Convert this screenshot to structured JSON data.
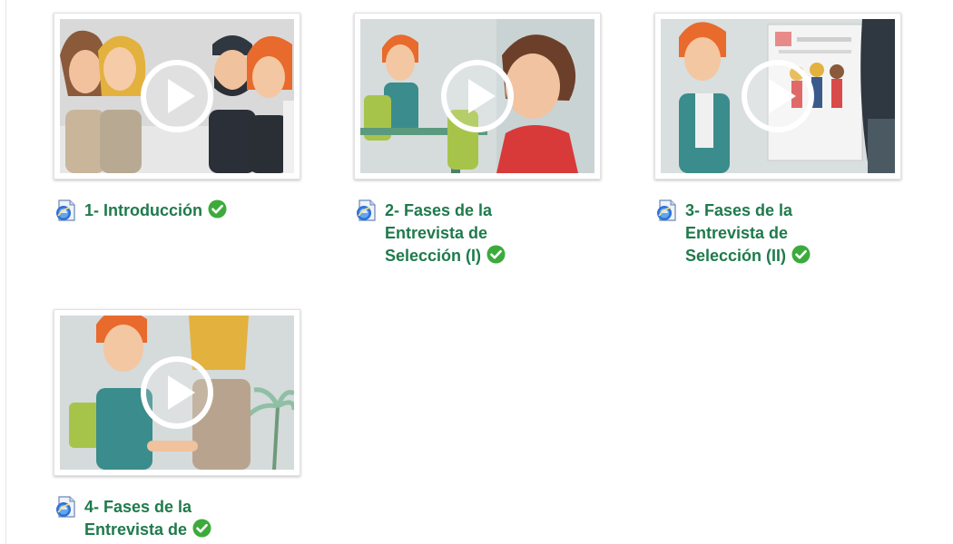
{
  "activities": [
    {
      "title": "1- Introducción",
      "completed": true,
      "icon": "video-resource-icon"
    },
    {
      "title": "2- Fases de la Entrevista de Selección (I)",
      "completed": true,
      "icon": "video-resource-icon"
    },
    {
      "title": "3- Fases de la Entrevista de Selección (II)",
      "completed": true,
      "icon": "video-resource-icon"
    },
    {
      "title": "4- Fases de la Entrevista de",
      "completed": true,
      "icon": "video-resource-icon"
    }
  ],
  "colors": {
    "title_text": "#1f7a4c",
    "check_green": "#3cab3c",
    "thumb_background": "#d9d9d9"
  }
}
